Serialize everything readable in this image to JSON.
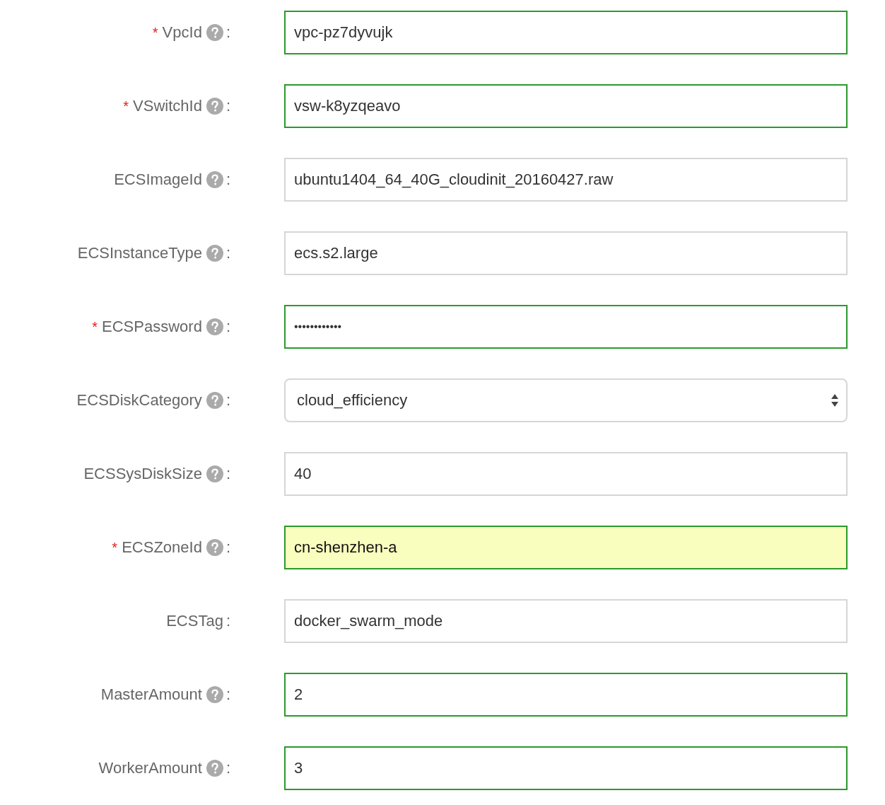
{
  "fields": [
    {
      "label": "VpcId",
      "required": true,
      "help": true,
      "suffix": ":",
      "kind": "text",
      "value": "vpc-pz7dyvujk",
      "valid": true,
      "autofilled": false
    },
    {
      "label": "VSwitchId",
      "required": true,
      "help": true,
      "suffix": ":",
      "kind": "text",
      "value": "vsw-k8yzqeavo",
      "valid": true,
      "autofilled": false
    },
    {
      "label": "ECSImageId",
      "required": false,
      "help": true,
      "suffix": ":",
      "kind": "text",
      "value": "ubuntu1404_64_40G_cloudinit_20160427.raw",
      "valid": false,
      "autofilled": false
    },
    {
      "label": "ECSInstanceType",
      "required": false,
      "help": true,
      "suffix": ":",
      "kind": "text",
      "value": "ecs.s2.large",
      "valid": false,
      "autofilled": false
    },
    {
      "label": "ECSPassword",
      "required": true,
      "help": true,
      "suffix": ":",
      "kind": "password",
      "value": "••••••••••••",
      "valid": true,
      "autofilled": false
    },
    {
      "label": "ECSDiskCategory",
      "required": false,
      "help": true,
      "suffix": ":",
      "kind": "select",
      "value": "cloud_efficiency",
      "valid": false,
      "autofilled": false
    },
    {
      "label": "ECSSysDiskSize",
      "required": false,
      "help": true,
      "suffix": ":",
      "kind": "text",
      "value": "40",
      "valid": false,
      "autofilled": false
    },
    {
      "label": "ECSZoneId",
      "required": true,
      "help": true,
      "suffix": ":",
      "kind": "text",
      "value": "cn-shenzhen-a",
      "valid": true,
      "autofilled": true
    },
    {
      "label": "ECSTag",
      "required": false,
      "help": false,
      "suffix": ":",
      "kind": "text",
      "value": "docker_swarm_mode",
      "valid": false,
      "autofilled": false
    },
    {
      "label": "MasterAmount",
      "required": false,
      "help": true,
      "suffix": ":",
      "kind": "text",
      "value": "2",
      "valid": true,
      "autofilled": false
    },
    {
      "label": "WorkerAmount",
      "required": false,
      "help": true,
      "suffix": ":",
      "kind": "text",
      "value": "3",
      "valid": true,
      "autofilled": false
    }
  ],
  "required_mark": "*"
}
